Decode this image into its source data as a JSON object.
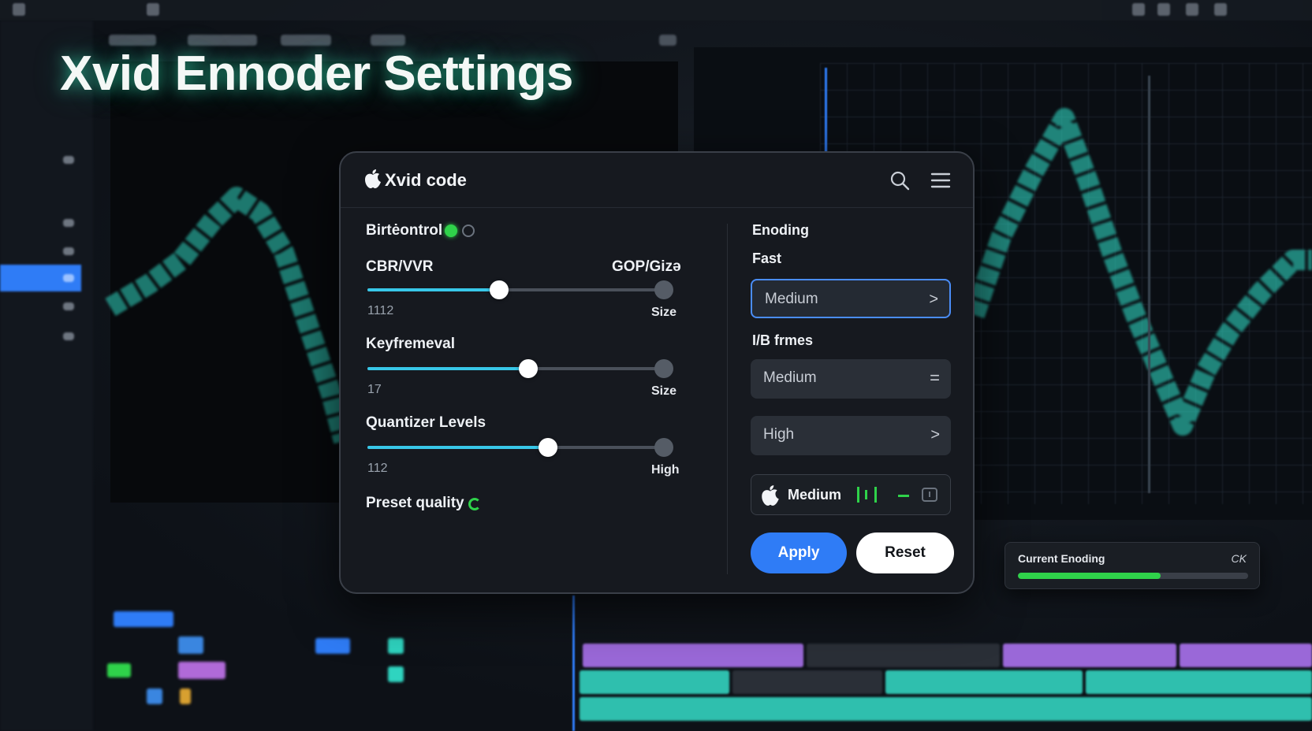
{
  "hero": {
    "title": "Xvid Ennoder Settings"
  },
  "dialog": {
    "title": "Xvid code",
    "left": {
      "bitrate_control": {
        "label": "Birtėontrol",
        "enabled": true
      },
      "cbr_vbr": {
        "label": "CBR/VVR",
        "right_label": "GOP/Gizə",
        "value_text": "1112",
        "side_label": "Size",
        "level": 0.45
      },
      "keyframe": {
        "label": "Keyfremeval",
        "value_text": "17",
        "side_label": "Size",
        "level": 0.55
      },
      "quantizer": {
        "label": "Quantizer Levels",
        "value_text": "112",
        "side_label": "High",
        "level": 0.62
      },
      "preset_quality": {
        "label": "Preset quality"
      }
    },
    "right": {
      "section_title": "Enoding",
      "speed_label": "Fast",
      "speed_select": {
        "value": "Medium",
        "icon": "chevron-right-icon"
      },
      "ib_label": "I/B frmes",
      "ib_select": {
        "value": "Medium",
        "icon": "equals-icon"
      },
      "quality_select": {
        "value": "High",
        "icon": "chevron-right-icon"
      },
      "profile": {
        "value": "Medium",
        "icon": "apple-icon"
      },
      "apply_label": "Apply",
      "reset_label": "Reset"
    }
  },
  "current_encoding": {
    "title": "Current Enoding",
    "status": "CK",
    "progress": 0.62
  },
  "colors": {
    "accent": "#2f7cf6",
    "slider_fill": "#38c7e8",
    "success": "#2fd24a",
    "waveform": "#2fd4c0"
  }
}
